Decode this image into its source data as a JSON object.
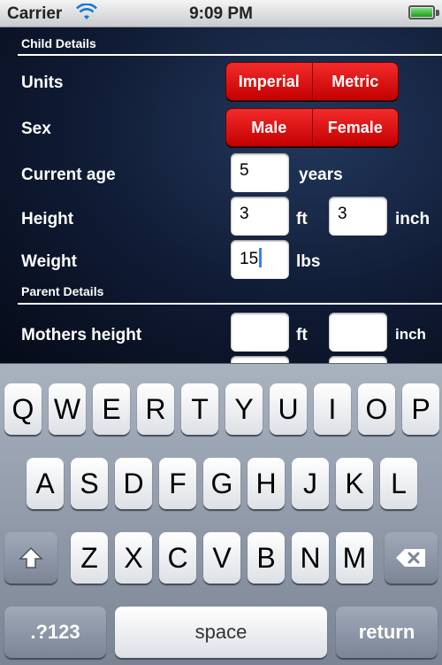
{
  "status_bar": {
    "carrier": "Carrier",
    "time": "9:09 PM"
  },
  "child_details": {
    "header": "Child Details",
    "units": {
      "label": "Units",
      "options": [
        "Imperial",
        "Metric"
      ]
    },
    "sex": {
      "label": "Sex",
      "options": [
        "Male",
        "Female"
      ]
    },
    "current_age": {
      "label": "Current age",
      "value": "5",
      "unit": "years"
    },
    "height": {
      "label": "Height",
      "ft_value": "3",
      "ft_unit": "ft",
      "inch_value": "3",
      "inch_unit": "inch"
    },
    "weight": {
      "label": "Weight",
      "value": "15",
      "unit": "lbs"
    }
  },
  "parent_details": {
    "header": "Parent Details",
    "mothers_height": {
      "label": "Mothers height",
      "ft_value": "",
      "ft_unit": "ft",
      "inch_value": "",
      "inch_unit": "inch"
    }
  },
  "keyboard": {
    "row1": [
      "Q",
      "W",
      "E",
      "R",
      "T",
      "Y",
      "U",
      "I",
      "O",
      "P"
    ],
    "row2": [
      "A",
      "S",
      "D",
      "F",
      "G",
      "H",
      "J",
      "K",
      "L"
    ],
    "row3": [
      "Z",
      "X",
      "C",
      "V",
      "B",
      "N",
      "M"
    ],
    "numbers_key": ".?123",
    "space_key": "space",
    "return_key": "return"
  },
  "colors": {
    "segment_red": "#e01010",
    "keyboard_bg": "#8c95a3",
    "form_bg": "#0f1a33"
  }
}
